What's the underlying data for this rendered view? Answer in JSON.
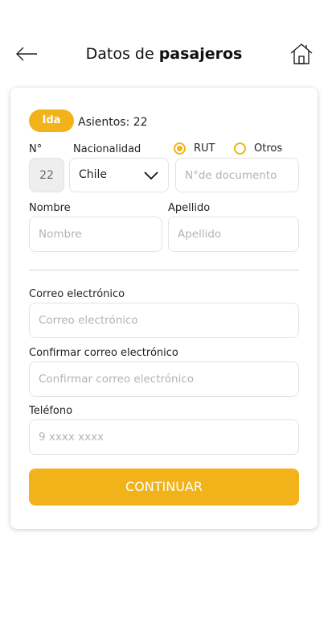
{
  "header": {
    "title_prefix": "Datos de ",
    "title_bold": "pasajeros",
    "back_icon": "arrow-left-icon",
    "home_icon": "home-icon"
  },
  "trip": {
    "direction_badge": "Ida",
    "seats_label": "Asientos: 22"
  },
  "form": {
    "number_label": "N°",
    "number_value": "22",
    "nationality_label": "Nacionalidad",
    "nationality_value": "Chile",
    "doc_types": [
      {
        "label": "RUT",
        "selected": true
      },
      {
        "label": "Otros",
        "selected": false
      }
    ],
    "doc_placeholder": "N°de documento",
    "first_name_label": "Nombre",
    "first_name_placeholder": "Nombre",
    "last_name_label": "Apellido",
    "last_name_placeholder": "Apellido",
    "email_label": "Correo electrónico",
    "email_placeholder": "Correo electrónico",
    "email_confirm_label": "Confirmar correo electrónico",
    "email_confirm_placeholder": "Confirmar correo electrónico",
    "phone_label": "Teléfono",
    "phone_placeholder": "9 xxxx xxxx",
    "submit_label": "CONTINUAR"
  },
  "colors": {
    "accent": "#f2b31a",
    "border": "#e3e3e3"
  }
}
